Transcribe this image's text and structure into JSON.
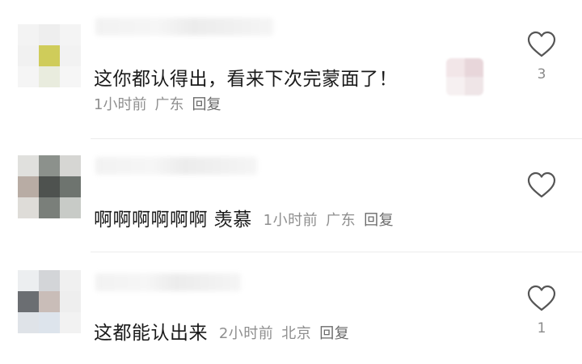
{
  "comments": [
    {
      "text": "这你都认得出，看来下次完蒙面了！",
      "time": "1小时前",
      "location": "广东",
      "reply_label": "回复",
      "like_count": "3"
    },
    {
      "text": "啊啊啊啊啊啊 羡慕",
      "time": "1小时前",
      "location": "广东",
      "reply_label": "回复",
      "like_count": ""
    },
    {
      "text": "这都能认出来",
      "time": "2小时前",
      "location": "北京",
      "reply_label": "回复",
      "like_count": "1"
    }
  ],
  "icons": {
    "like": "heart-outline-icon"
  },
  "colors": {
    "text": "#1a1a1a",
    "meta": "#8f8f8f",
    "divider": "#ececec"
  }
}
